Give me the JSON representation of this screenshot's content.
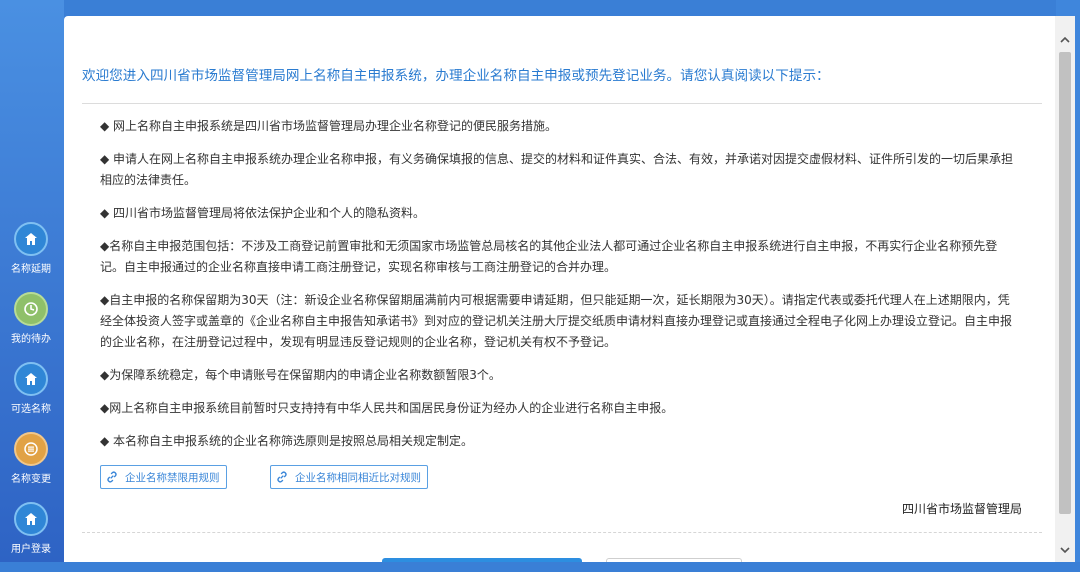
{
  "sidebar": {
    "items": [
      {
        "label": "名称延期",
        "icon": "house-icon",
        "color": "#2f86d6"
      },
      {
        "label": "我的待办",
        "icon": "clock-icon",
        "color": "#8fc06a"
      },
      {
        "label": "可选名称",
        "icon": "house-icon",
        "color": "#2f86d6"
      },
      {
        "label": "名称变更",
        "icon": "list-icon",
        "color": "#e1a245"
      },
      {
        "label": "用户登录",
        "icon": "house-icon",
        "color": "#2f86d6"
      }
    ]
  },
  "dialog": {
    "intro": "欢迎您进入四川省市场监督管理局网上名称自主申报系统，办理企业名称自主申报或预先登记业务。请您认真阅读以下提示：",
    "notes": [
      "◆ 网上名称自主申报系统是四川省市场监督管理局办理企业名称登记的便民服务措施。",
      "◆ 申请人在网上名称自主申报系统办理企业名称申报，有义务确保填报的信息、提交的材料和证件真实、合法、有效，并承诺对因提交虚假材料、证件所引发的一切后果承担相应的法律责任。",
      "◆ 四川省市场监督管理局将依法保护企业和个人的隐私资料。",
      "◆名称自主申报范围包括：不涉及工商登记前置审批和无须国家市场监管总局核名的其他企业法人都可通过企业名称自主申报系统进行自主申报，不再实行企业名称预先登记。自主申报通过的企业名称直接申请工商注册登记，实现名称审核与工商注册登记的合并办理。",
      "◆自主申报的名称保留期为30天（注：新设企业名称保留期届满前内可根据需要申请延期，但只能延期一次，延长期限为30天）。请指定代表或委托代理人在上述期限内，凭经全体投资人签字或盖章的《企业名称自主申报告知承诺书》到对应的登记机关注册大厅提交纸质申请材料直接办理登记或直接通过全程电子化网上办理设立登记。自主申报的企业名称，在注册登记过程中，发现有明显违反登记规则的企业名称，登记机关有权不予登记。",
      "◆为保障系统稳定，每个申请账号在保留期内的申请企业名称数额暂限3个。",
      "◆网上名称自主申报系统目前暂时只支持持有中华人民共和国居民身份证为经办人的企业进行名称自主申报。",
      "◆ 本名称自主申报系统的企业名称筛选原则是按照总局相关规定制定。"
    ],
    "links": [
      {
        "label": "企业名称禁限用规则",
        "icon": "link-icon"
      },
      {
        "label": "企业名称相同相近比对规则",
        "icon": "link-icon"
      }
    ],
    "signature": "四川省市场监督管理局"
  },
  "colors": {
    "accent": "#2a7bd0",
    "primary_button": "#2d8ee0",
    "background": "#3a7fd6"
  }
}
